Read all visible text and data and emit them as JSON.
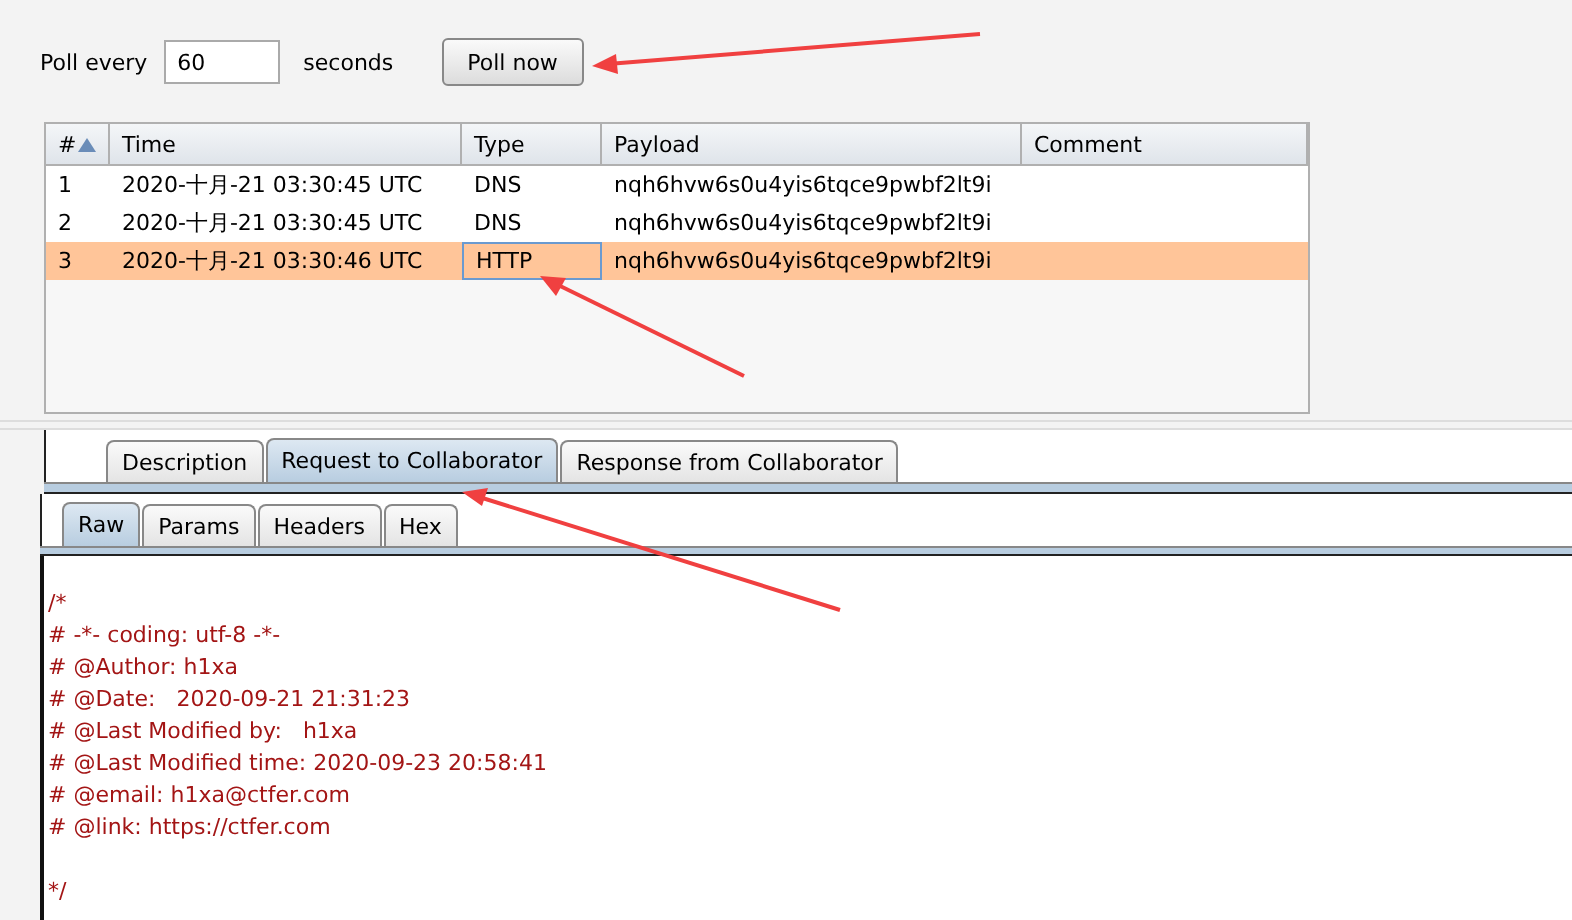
{
  "poll": {
    "label": "Poll every",
    "value": "60",
    "unit": "seconds",
    "button": "Poll now"
  },
  "table": {
    "columns": [
      {
        "label": "#",
        "sorted": true
      },
      {
        "label": "Time",
        "sorted": false
      },
      {
        "label": "Type",
        "sorted": false
      },
      {
        "label": "Payload",
        "sorted": false
      },
      {
        "label": "Comment",
        "sorted": false
      }
    ],
    "rows": [
      {
        "cells": [
          "1",
          "2020-十月-21 03:30:45 UTC",
          "DNS",
          "nqh6hvw6s0u4yis6tqce9pwbf2lt9i",
          ""
        ],
        "selected": false
      },
      {
        "cells": [
          "2",
          "2020-十月-21 03:30:45 UTC",
          "DNS",
          "nqh6hvw6s0u4yis6tqce9pwbf2lt9i",
          ""
        ],
        "selected": false
      },
      {
        "cells": [
          "3",
          "2020-十月-21 03:30:46 UTC",
          "HTTP",
          "nqh6hvw6s0u4yis6tqce9pwbf2lt9i",
          ""
        ],
        "selected": true
      }
    ]
  },
  "tabs": [
    {
      "label": "Description",
      "selected": false
    },
    {
      "label": "Request to Collaborator",
      "selected": true
    },
    {
      "label": "Response from Collaborator",
      "selected": false
    }
  ],
  "subtabs": [
    {
      "label": "Raw",
      "selected": true
    },
    {
      "label": "Params",
      "selected": false
    },
    {
      "label": "Headers",
      "selected": false
    },
    {
      "label": "Hex",
      "selected": false
    }
  ],
  "content": [
    {
      "kind": "blank"
    },
    {
      "kind": "text",
      "text": "/*"
    },
    {
      "kind": "text",
      "text": "# -*- coding: utf-8 -*-"
    },
    {
      "kind": "text",
      "text": "# @Author: h1xa"
    },
    {
      "kind": "text",
      "text": "# @Date:   2020-09-21 21:31:23"
    },
    {
      "kind": "text",
      "text": "# @Last Modified by:   h1xa"
    },
    {
      "kind": "text",
      "text": "# @Last Modified time: 2020-09-23 20:58:41"
    },
    {
      "kind": "text",
      "text": "# @email: h1xa@ctfer.com"
    },
    {
      "kind": "text",
      "text": "# @link: https://ctfer.com"
    },
    {
      "kind": "blank"
    },
    {
      "kind": "text",
      "text": "*/"
    }
  ]
}
